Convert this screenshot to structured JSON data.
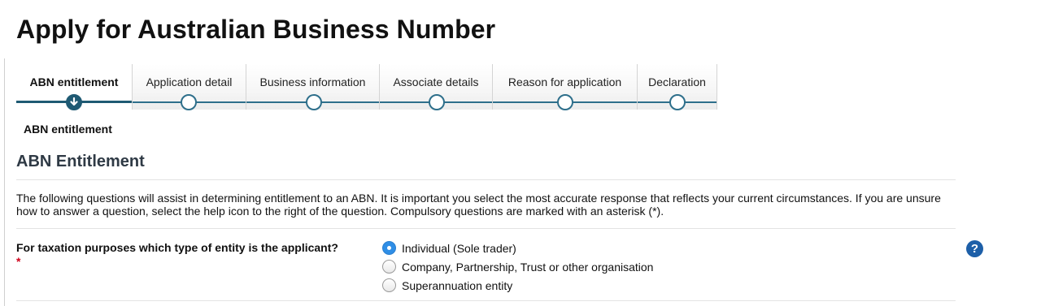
{
  "page": {
    "title": "Apply for Australian Business Number"
  },
  "stepper": {
    "steps": [
      {
        "label": "ABN entitlement",
        "active": true
      },
      {
        "label": "Application detail",
        "active": false
      },
      {
        "label": "Business information",
        "active": false
      },
      {
        "label": "Associate details",
        "active": false
      },
      {
        "label": "Reason for application",
        "active": false
      },
      {
        "label": "Declaration",
        "active": false
      }
    ],
    "current_step": "ABN entitlement"
  },
  "section": {
    "title": "ABN Entitlement",
    "intro": "The following questions will assist in determining entitlement to an ABN. It is important you select the most accurate response that reflects your current circumstances. If you are unsure how to answer a question, select the help icon to the right of the question. Compulsory questions are marked with an asterisk (*)."
  },
  "question": {
    "text": "For taxation purposes which type of entity is the applicant?",
    "required_marker": "*",
    "options": [
      {
        "label": "Individual (Sole trader)",
        "selected": true
      },
      {
        "label": "Company, Partnership, Trust or other organisation",
        "selected": false
      },
      {
        "label": "Superannuation entity",
        "selected": false
      }
    ],
    "help_glyph": "?"
  },
  "colors": {
    "stepper_accent": "#2e6f8b",
    "radio_selected": "#2f8ee6",
    "help_icon": "#1d5fa8",
    "required": "#d0021b"
  },
  "icons": {
    "active_step": "down-arrow-icon",
    "help": "help-icon"
  }
}
